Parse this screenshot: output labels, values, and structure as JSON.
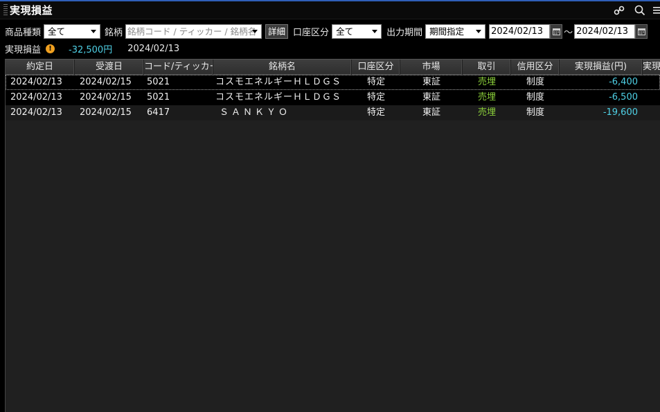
{
  "window": {
    "title": "実現損益",
    "icons": [
      "link-icon",
      "search-icon",
      "menu-icon"
    ]
  },
  "filters": {
    "product_type_label": "商品種類",
    "product_type_value": "全て",
    "symbol_label": "銘柄",
    "symbol_placeholder": "銘柄コード / ティッカー / 銘柄名",
    "detail_button": "詳細",
    "account_type_label": "口座区分",
    "account_type_value": "全て",
    "output_period_label": "出力期間",
    "output_period_value": "期間指定",
    "date_from": "2024/02/13",
    "date_separator": "～",
    "date_to": "2024/02/13"
  },
  "summary": {
    "label": "実現損益",
    "value": "-32,500円",
    "date": "2024/02/13",
    "value_color": "#4fd1e6"
  },
  "table": {
    "headers": [
      "約定日",
      "受渡日",
      "コード/ティッカー",
      "銘柄名",
      "口座区分",
      "市場",
      "取引",
      "信用区分",
      "実現損益(円)",
      "実現"
    ],
    "rows": [
      [
        "2024/02/13",
        "2024/02/15",
        "5021",
        "コスモエネルギーＨＬＤＧＳ",
        "特定",
        "東証",
        "売埋",
        "制度",
        "-6,400",
        ""
      ],
      [
        "2024/02/13",
        "2024/02/15",
        "5021",
        "コスモエネルギーＨＬＤＧＳ",
        "特定",
        "東証",
        "売埋",
        "制度",
        "-6,500",
        ""
      ],
      [
        "2024/02/13",
        "2024/02/15",
        "6417",
        "ＳＡＮＫＹＯ",
        "特定",
        "東証",
        "売埋",
        "制度",
        "-19,600",
        ""
      ]
    ],
    "colors": {
      "trade": "#8cd13a",
      "pnl_negative": "#4fd1e6"
    }
  }
}
